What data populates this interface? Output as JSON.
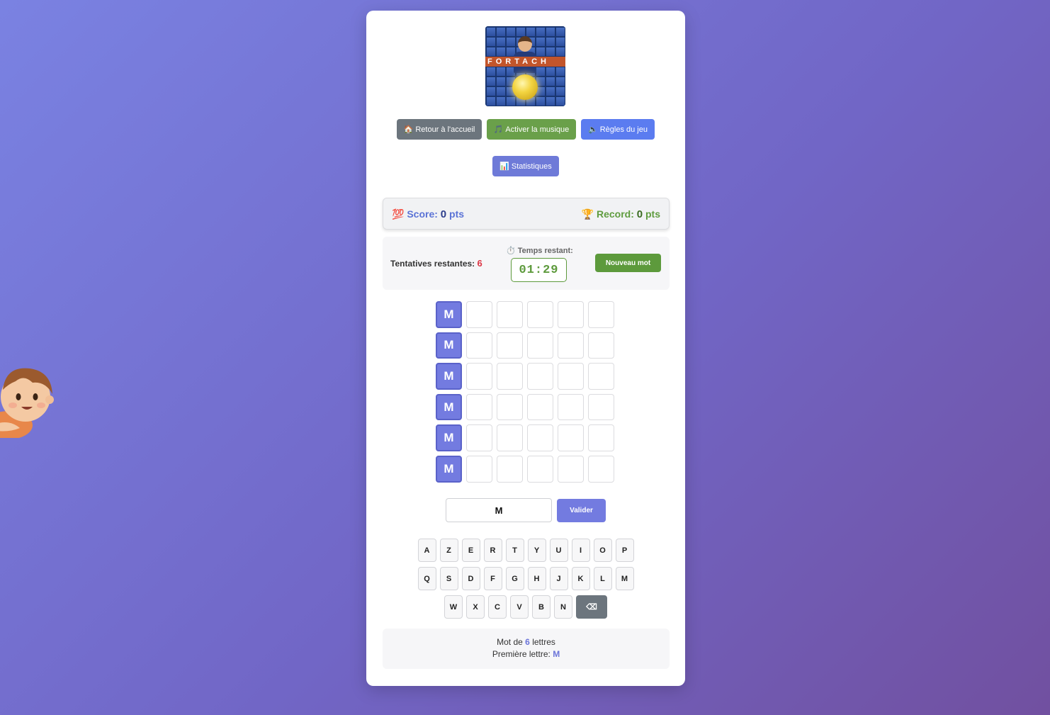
{
  "logo": {
    "band_text": "FORTACH"
  },
  "nav": {
    "home": {
      "icon": "🏠",
      "label": "Retour à l'accueil"
    },
    "music": {
      "icon": "🎵",
      "label": "Activer la musique"
    },
    "rules": {
      "icon": "🔈",
      "label": "Règles du jeu"
    },
    "stats": {
      "icon": "📊",
      "label": "Statistiques"
    }
  },
  "score": {
    "icon": "💯",
    "label": "Score:",
    "value": "0",
    "unit": "pts"
  },
  "record": {
    "icon": "🏆",
    "label": "Record:",
    "value": "0",
    "unit": "pts"
  },
  "status": {
    "attempts_label": "Tentatives restantes:",
    "attempts_value": "6",
    "time_icon": "⏱️",
    "time_label": "Temps restant:",
    "timer": "01:29",
    "new_word_label": "Nouveau mot"
  },
  "grid": {
    "rows": [
      [
        "M",
        "",
        "",
        "",
        "",
        ""
      ],
      [
        "M",
        "",
        "",
        "",
        "",
        ""
      ],
      [
        "M",
        "",
        "",
        "",
        "",
        ""
      ],
      [
        "M",
        "",
        "",
        "",
        "",
        ""
      ],
      [
        "M",
        "",
        "",
        "",
        "",
        ""
      ],
      [
        "M",
        "",
        "",
        "",
        "",
        ""
      ]
    ]
  },
  "input": {
    "value": "M",
    "validate_label": "Valider"
  },
  "keyboard": {
    "row1": [
      "A",
      "Z",
      "E",
      "R",
      "T",
      "Y",
      "U",
      "I",
      "O",
      "P"
    ],
    "row2": [
      "Q",
      "S",
      "D",
      "F",
      "G",
      "H",
      "J",
      "K",
      "L",
      "M"
    ],
    "row3": [
      "W",
      "X",
      "C",
      "V",
      "B",
      "N"
    ],
    "backspace": "⌫"
  },
  "info": {
    "word_prefix": "Mot de",
    "word_length": "6",
    "word_suffix": "lettres",
    "first_letter_label": "Première lettre:",
    "first_letter": "M"
  },
  "colors": {
    "accent": "#737be0",
    "success": "#5d9a3c",
    "danger": "#dc3545",
    "neutral": "#6c757d"
  },
  "icons": {
    "mascot": "cartoon-boy-mascot"
  }
}
